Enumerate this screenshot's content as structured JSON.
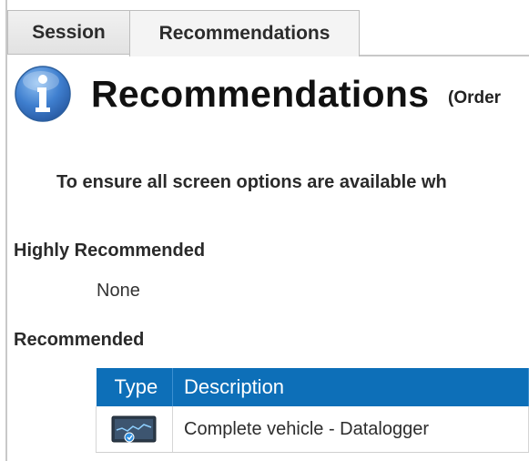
{
  "tabs": [
    {
      "label": "Session",
      "active": false
    },
    {
      "label": "Recommendations",
      "active": true
    }
  ],
  "header": {
    "icon": "info-icon",
    "title": "Recommendations",
    "subtitle": "(Order"
  },
  "intro": {
    "text": "To ensure all screen options are available wh"
  },
  "sections": {
    "highly_recommended": {
      "heading": "Highly Recommended",
      "empty_text": "None"
    },
    "recommended": {
      "heading": "Recommended",
      "columns": [
        "Type",
        "Description"
      ],
      "rows": [
        {
          "type_icon": "datalogger-device-icon",
          "description": "Complete vehicle - Datalogger"
        }
      ]
    }
  },
  "colors": {
    "table_header": "#0d6fb8",
    "info_icon": "#3f7fcf"
  }
}
